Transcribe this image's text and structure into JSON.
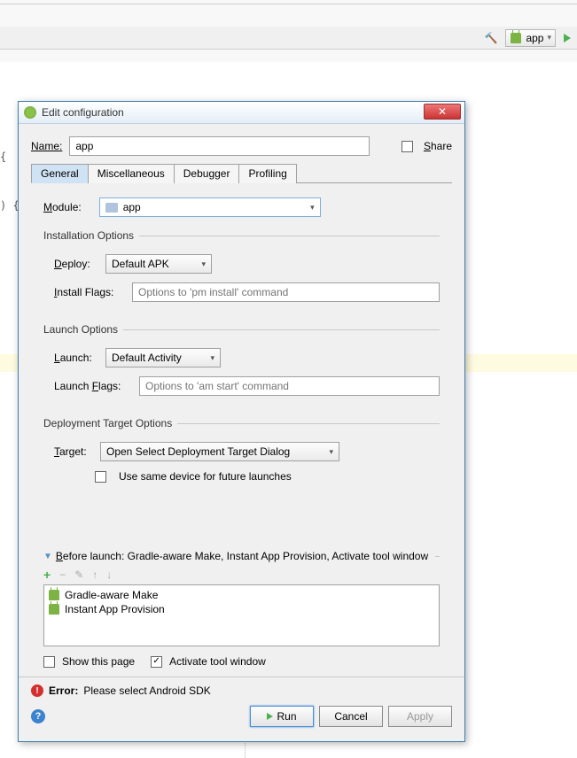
{
  "toolbar": {
    "module_name": "app"
  },
  "code_fragments": [
    "{",
    ") {"
  ],
  "dialog": {
    "title": "Edit configuration",
    "name_label": "Name:",
    "name_value": "app",
    "share_label": "Share",
    "share_checked": false,
    "tabs": [
      "General",
      "Miscellaneous",
      "Debugger",
      "Profiling"
    ],
    "active_tab": "General",
    "module_label": "Module:",
    "module_value": "app",
    "installation": {
      "legend": "Installation Options",
      "deploy_label": "Deploy:",
      "deploy_value": "Default APK",
      "install_flags_label": "Install Flags:",
      "install_flags_placeholder": "Options to 'pm install' command"
    },
    "launch": {
      "legend": "Launch Options",
      "launch_label": "Launch:",
      "launch_value": "Default Activity",
      "launch_flags_label": "Launch Flags:",
      "launch_flags_placeholder": "Options to 'am start' command"
    },
    "deployment": {
      "legend": "Deployment Target Options",
      "target_label": "Target:",
      "target_value": "Open Select Deployment Target Dialog",
      "same_device_label": "Use same device for future launches",
      "same_device_checked": false
    },
    "before_launch": {
      "header": "Before launch: Gradle-aware Make, Instant App Provision, Activate tool window",
      "items": [
        "Gradle-aware Make",
        "Instant App Provision"
      ]
    },
    "show_page_label": "Show this page",
    "show_page_checked": false,
    "activate_tool_label": "Activate tool window",
    "activate_tool_checked": true,
    "error_label": "Error:",
    "error_msg": "Please select Android SDK",
    "buttons": {
      "run": "Run",
      "cancel": "Cancel",
      "apply": "Apply"
    }
  }
}
